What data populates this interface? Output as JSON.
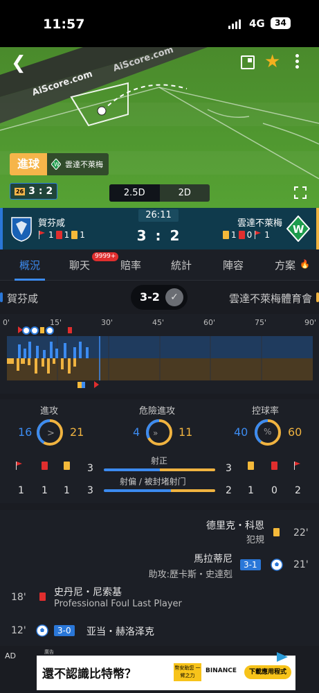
{
  "statusbar": {
    "time": "11:57",
    "network": "4G",
    "battery": "34"
  },
  "pitch": {
    "watermark_1": "AiScore.com",
    "watermark_2": "AiScore.com",
    "goal_tag": "進球",
    "goal_team": "雲達不萊梅",
    "mini_score_home": "3",
    "mini_score_sep": ":",
    "mini_score_away": "2",
    "mini_minute": "26",
    "view_2_5d": "2.5D",
    "view_2d": "2D"
  },
  "match": {
    "home_name": "賀芬咸",
    "away_name": "雲達不萊梅",
    "clock": "26:11",
    "score": "3 : 2",
    "home_corners": "1",
    "home_red": "1",
    "home_yellow": "1",
    "away_yellow": "1",
    "away_red": "1",
    "away_red_count": "0",
    "away_corners": "1",
    "colors": {
      "home": "#2a77d8",
      "away": "#f0b340"
    }
  },
  "tabs": [
    {
      "label": "概況"
    },
    {
      "label": "聊天"
    },
    {
      "label": "賠率"
    },
    {
      "label": "統計"
    },
    {
      "label": "陣容"
    },
    {
      "label": "方案"
    }
  ],
  "chat_badge": "9999+",
  "filter": {
    "home_name": "賀芬咸",
    "away_name": "雲達不萊梅體育會",
    "score": "3-2"
  },
  "timeline": {
    "labels": [
      "0'",
      "15'",
      "30'",
      "45'",
      "60'",
      "75'",
      "90'"
    ],
    "current_minute": 26
  },
  "stats": {
    "attack": {
      "title": "進攻",
      "home": "16",
      "away": "21"
    },
    "dangerous": {
      "title": "危險進攻",
      "home": "4",
      "away": "11"
    },
    "possession": {
      "title": "控球率",
      "home": "40",
      "away": "60",
      "symbol": "%"
    },
    "home_corners": "1",
    "home_red": "1",
    "home_yellow": "1",
    "on_target": {
      "title": "射正",
      "home": "3",
      "away": "3"
    },
    "off_target": {
      "title": "射偏 / 被封堵射门",
      "home": "3",
      "away": "2"
    },
    "away_yellow": "1",
    "away_red": "0",
    "away_corners": "2"
  },
  "events": [
    {
      "player": "德里克・科恩",
      "detail": "犯規",
      "minute": "22'"
    },
    {
      "player": "馬拉蒂尼",
      "detail": "助攻:歷卡斯・史達剋",
      "score": "3-1",
      "minute": "21'"
    },
    {
      "player": "史丹尼・尼索基",
      "detail": "Professional Foul Last Player",
      "minute": "18'"
    },
    {
      "player": "亚当・赫洛泽克",
      "score": "3-0",
      "minute": "12'"
    }
  ],
  "ad": {
    "label": "AD",
    "small": "廣告",
    "headline": "還不認識比特幣？",
    "badge": "幣安助您 一臂之力",
    "brand": "BINANCE",
    "cta": "下載應用程式"
  }
}
